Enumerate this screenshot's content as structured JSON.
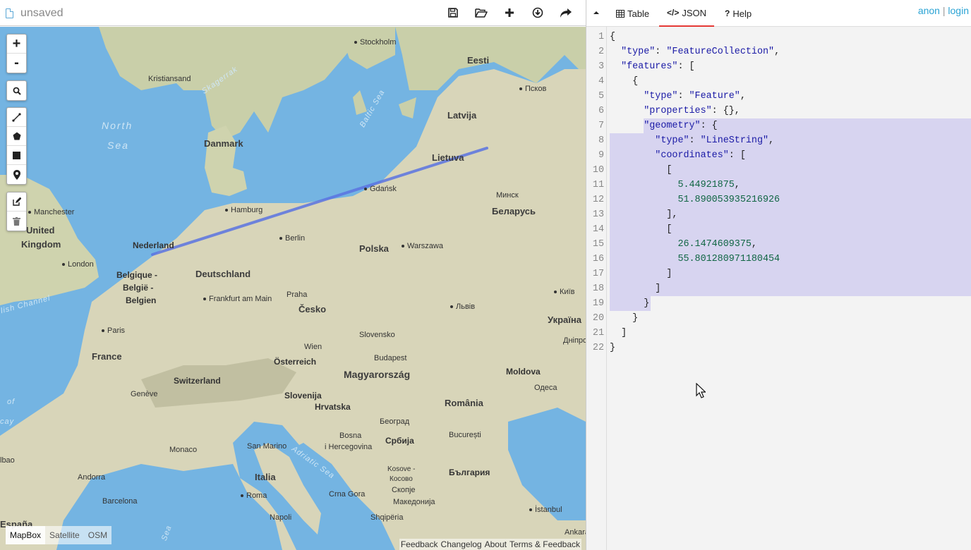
{
  "file": {
    "title": "unsaved"
  },
  "toolbar": {
    "save": "save-icon",
    "open": "open-icon",
    "new": "plus-icon",
    "download": "download-icon",
    "share": "share-icon"
  },
  "map": {
    "controls": {
      "zoom_in": "+",
      "zoom_out": "-"
    },
    "labels": {
      "stockholm": "Stockholm",
      "eesti": "Eesti",
      "kristiansand": "Kristiansand",
      "pskov": "Псков",
      "north_sea_1": "North",
      "north_sea_2": "Sea",
      "skagerrak": "Skagerrak",
      "baltic": "Baltic Sea",
      "latvija": "Latvija",
      "danmark": "Danmark",
      "lietuva": "Lietuva",
      "gdansk": "Gdańsk",
      "minsk": "Минск",
      "manchester": "Manchester",
      "hamburg": "Hamburg",
      "belarus": "Беларусь",
      "united_1": "United",
      "united_2": "Kingdom",
      "nederland": "Nederland",
      "berlin": "Berlin",
      "polska": "Polska",
      "warszawa": "Warszawa",
      "london": "London",
      "belgique_1": "Belgique -",
      "belgique_2": "België -",
      "belgique_3": "Belgien",
      "deutschland": "Deutschland",
      "kiev": "Київ",
      "english_channel": "lish Channel",
      "praha": "Praha",
      "frankfurt": "Frankfurt am Main",
      "cesko": "Česko",
      "lviv": "Львів",
      "ukraina": "Україна",
      "paris": "Paris",
      "slovensko": "Slovensko",
      "dnipro": "Дніпро",
      "wien": "Wien",
      "france": "France",
      "budapest": "Budapest",
      "osterreich": "Österreich",
      "magyarorszag": "Magyarország",
      "moldova": "Moldova",
      "switzerland": "Switzerland",
      "odesa": "Одеса",
      "geneve": "Genève",
      "slovenija": "Slovenija",
      "of": "of",
      "hrvatska": "Hrvatska",
      "romania": "România",
      "cay": "cay",
      "beograd": "Београд",
      "bosna_1": "Bosna",
      "bosna_2": "i Hercegovina",
      "srbija": "Србија",
      "bucuresti": "București",
      "monaco": "Monaco",
      "san_marino": "San Marino",
      "adriatic": "Adriatic Sea",
      "kosovo_1": "Kosove -",
      "kosovo_2": "Косово",
      "bulgaria": "България",
      "bao": "lbao",
      "andorra": "Andorra",
      "italia": "Italia",
      "skopje": "Скопје",
      "makedonija": "Македонија",
      "barcelona": "Barcelona",
      "roma": "Roma",
      "crna_gora": "Crna Gora",
      "istanbul": "İstanbul",
      "shqiperia": "Shqipëria",
      "napoli": "Napoli",
      "espana": "España",
      "sea_bottom": "Sea",
      "ankara": "Ankara"
    },
    "layers": [
      "MapBox",
      "Satellite",
      "OSM"
    ],
    "attribution": [
      "Feedback",
      "Changelog",
      "About",
      "Terms & Feedback"
    ],
    "line_color": "#5b73e0"
  },
  "tabs": {
    "table": "Table",
    "json": "JSON",
    "help": "Help"
  },
  "auth": {
    "anon": "anon",
    "sep": " | ",
    "login": "login"
  },
  "editor": {
    "lines": [
      "{",
      "  \"type\": \"FeatureCollection\",",
      "  \"features\": [",
      "    {",
      "      \"type\": \"Feature\",",
      "      \"properties\": {},",
      "      \"geometry\": {",
      "        \"type\": \"LineString\",",
      "        \"coordinates\": [",
      "          [",
      "            5.44921875,",
      "            51.890053935216926",
      "          ],",
      "          [",
      "            26.1474609375,",
      "            55.801280971180454",
      "          ]",
      "        ]",
      "      }",
      "    }",
      "  ]",
      "}"
    ],
    "highlight_from_line": 7,
    "highlight_to_line": 19
  }
}
